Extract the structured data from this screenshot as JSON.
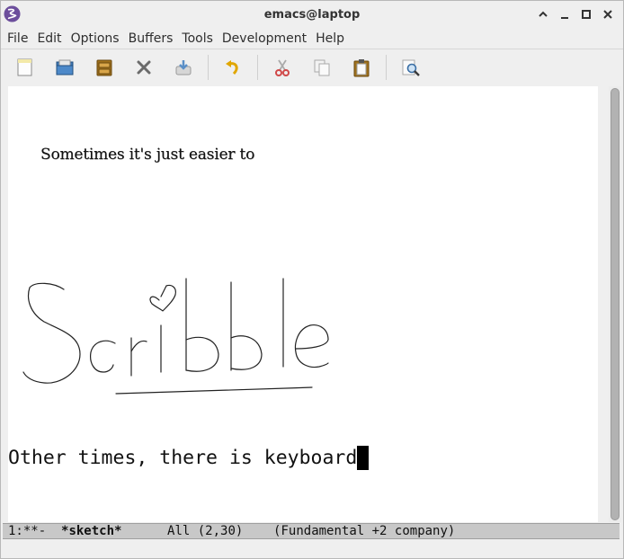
{
  "window": {
    "title": "emacs@laptop"
  },
  "menu": {
    "items": [
      "File",
      "Edit",
      "Options",
      "Buffers",
      "Tools",
      "Development",
      "Help"
    ]
  },
  "toolbar": {
    "buttons": [
      {
        "icon": "new-file-icon"
      },
      {
        "icon": "open-folder-icon"
      },
      {
        "icon": "open-directory-icon"
      },
      {
        "icon": "close-icon"
      },
      {
        "icon": "save-icon"
      },
      {
        "icon": "undo-icon"
      },
      {
        "icon": "cut-icon"
      },
      {
        "icon": "copy-icon"
      },
      {
        "icon": "paste-icon"
      },
      {
        "icon": "search-icon"
      }
    ]
  },
  "buffer": {
    "serif_line": "Sometimes it's just easier to",
    "mono_line": "Other times, there is keyboard"
  },
  "modeline": {
    "status": "1:**-  ",
    "buffer_name": "*sketch*",
    "position": "All (2,30)",
    "modes": "(Fundamental +2 company)"
  }
}
